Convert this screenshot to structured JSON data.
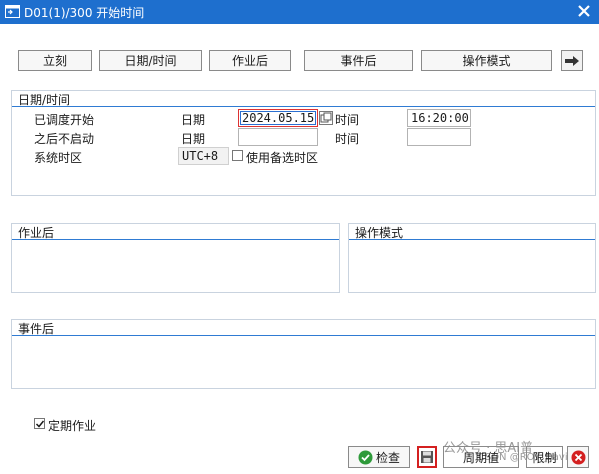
{
  "window": {
    "title": "D01(1)/300 开始时间"
  },
  "toolbar": {
    "immediate": "立刻",
    "datetime": "日期/时间",
    "after_job": "作业后",
    "after_event": "事件后",
    "operation_mode": "操作模式"
  },
  "datetime_group": {
    "title": "日期/时间",
    "scheduled_start_label": "已调度开始",
    "date_label": "日期",
    "date_value": "2024.05.15",
    "time_label": "时间",
    "time_value": "16:20:00",
    "no_start_after_label": "之后不启动",
    "no_start_date_label": "日期",
    "no_start_date_value": "",
    "no_start_time_label": "时间",
    "no_start_time_value": "",
    "timezone_label": "系统时区",
    "timezone_value": "UTC+8",
    "alt_timezone_label": "使用备选时区",
    "alt_timezone_checked": false
  },
  "after_job_group": {
    "title": "作业后"
  },
  "operation_mode_group": {
    "title": "操作模式"
  },
  "after_event_group": {
    "title": "事件后"
  },
  "periodic": {
    "label": "定期作业",
    "checked": true
  },
  "footer": {
    "check": "检查",
    "period": "周期值",
    "restrict": "限制"
  },
  "watermark": {
    "line1": "公众号 · 思AI普",
    "line2": "CSDN @ROY_Davie"
  },
  "colors": {
    "titlebar": "#1e6fce",
    "group_line": "#2f7bd3",
    "focus": "#d33333"
  }
}
